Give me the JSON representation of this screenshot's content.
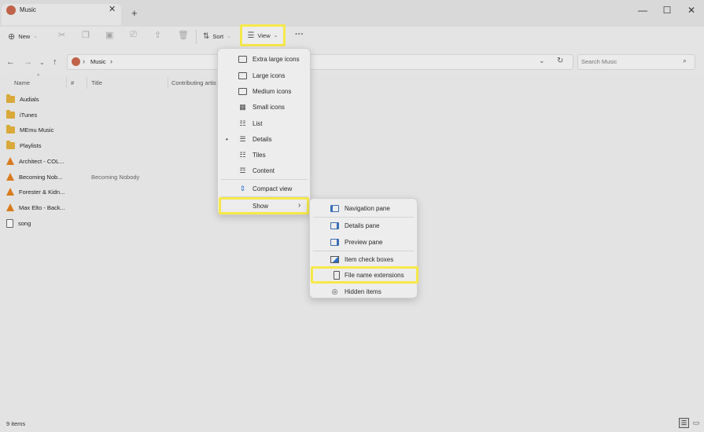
{
  "window": {
    "tab_title": "Music",
    "tab_close": "✕",
    "new_tab": "+",
    "minimize": "—",
    "maximize": "☐",
    "close": "✕"
  },
  "toolbar": {
    "new_label": "New",
    "sort_label": "Sort",
    "view_label": "View",
    "more": "···"
  },
  "address": {
    "crumb": "Music",
    "sep1": "›",
    "sep2": "›",
    "search_placeholder": "Search Music"
  },
  "columns": {
    "name": "Name",
    "number": "#",
    "title": "Title",
    "artist": "Contributing artis"
  },
  "files": [
    {
      "name": "Audials",
      "kind": "folder",
      "title": ""
    },
    {
      "name": "iTunes",
      "kind": "folder",
      "title": ""
    },
    {
      "name": "MEmu Music",
      "kind": "folder",
      "title": ""
    },
    {
      "name": "Playlists",
      "kind": "folder",
      "title": ""
    },
    {
      "name": "Architect - COL...",
      "kind": "vlc",
      "title": ""
    },
    {
      "name": "Becoming Nob...",
      "kind": "vlc",
      "title": "Becoming Nobody"
    },
    {
      "name": "Forester & Kidn...",
      "kind": "vlc",
      "title": ""
    },
    {
      "name": "Max Elto - Back...",
      "kind": "vlc",
      "title": ""
    },
    {
      "name": "song",
      "kind": "file",
      "title": ""
    }
  ],
  "view_menu": {
    "items": [
      {
        "label": "Extra large icons",
        "icon": "monitor-icon"
      },
      {
        "label": "Large icons",
        "icon": "monitor-icon"
      },
      {
        "label": "Medium icons",
        "icon": "monitor-icon"
      },
      {
        "label": "Small icons",
        "icon": "grid-icon"
      },
      {
        "label": "List",
        "icon": "list-icon"
      },
      {
        "label": "Details",
        "icon": "details-icon",
        "selected_mark": "•"
      },
      {
        "label": "Tiles",
        "icon": "tiles-icon"
      },
      {
        "label": "Content",
        "icon": "content-icon"
      },
      {
        "label": "Compact view",
        "icon": "compact-icon"
      },
      {
        "label": "Show",
        "icon": "",
        "arrow": "›"
      }
    ]
  },
  "show_menu": {
    "items": [
      {
        "label": "Navigation pane",
        "icon": "navigation-pane-icon"
      },
      {
        "label": "Details pane",
        "icon": "details-pane-icon"
      },
      {
        "label": "Preview pane",
        "icon": "preview-pane-icon"
      },
      {
        "label": "Item check boxes",
        "icon": "checkbox-icon"
      },
      {
        "label": "File name extensions",
        "icon": "file-icon"
      },
      {
        "label": "Hidden items",
        "icon": "eye-icon"
      }
    ]
  },
  "status": {
    "item_count": "9 items"
  },
  "colors": {
    "highlight": "#f6e84a",
    "folder": "#d9a93a",
    "vlc": "#d97a1e"
  }
}
